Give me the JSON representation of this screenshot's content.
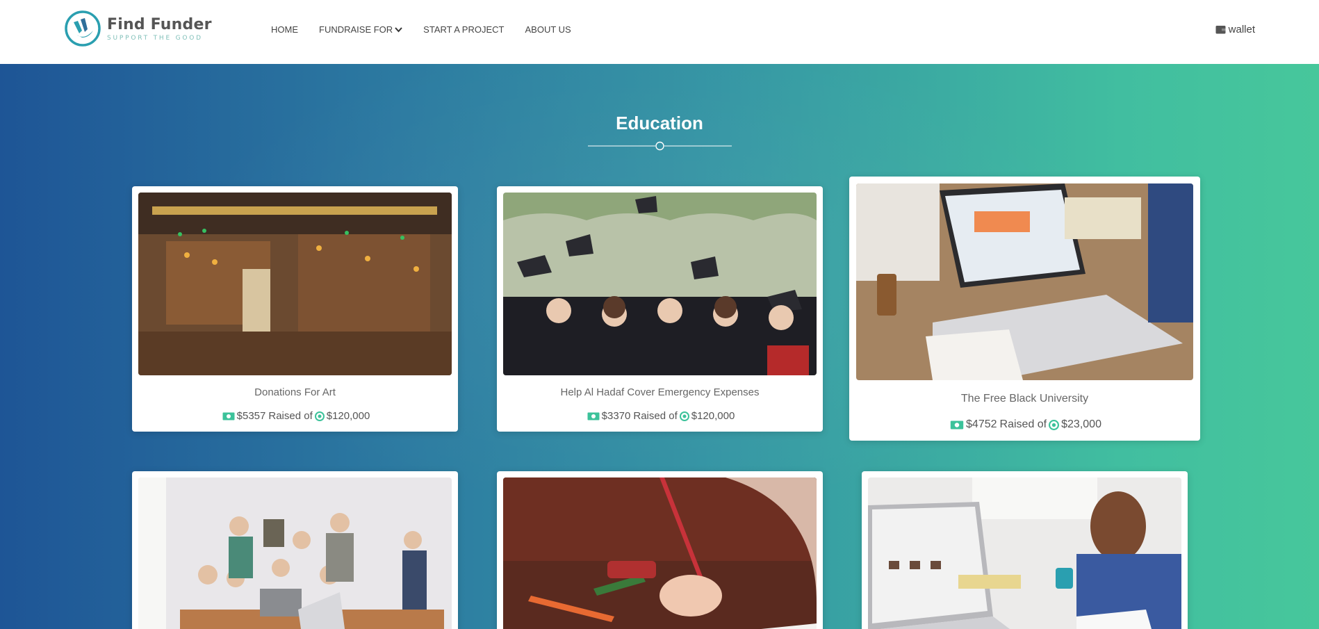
{
  "brand": {
    "name": "Find Funder",
    "tagline": "SUPPORT THE GOOD"
  },
  "nav": {
    "items": [
      {
        "label": "HOME"
      },
      {
        "label": "FUNDRAISE FOR"
      },
      {
        "label": "START A PROJECT"
      },
      {
        "label": "ABOUT US"
      }
    ],
    "wallet_label": "wallet"
  },
  "section": {
    "title": "Education"
  },
  "cards": [
    {
      "title": "Donations For Art",
      "raised": "$5357",
      "raised_of": "Raised of",
      "goal": "$120,000",
      "image": "library-reading-room"
    },
    {
      "title": "Help Al Hadaf Cover Emergency Expenses",
      "raised": "$3370",
      "raised_of": "Raised of",
      "goal": "$120,000",
      "image": "graduation-caps"
    },
    {
      "title": "The Free Black University",
      "raised": "$4752",
      "raised_of": "Raised of",
      "goal": "$23,000",
      "image": "laptop-desk"
    },
    {
      "image": "group-studying"
    },
    {
      "image": "child-drawing"
    },
    {
      "image": "man-writing-laptop"
    }
  ],
  "colors": {
    "accent": "#3cc29a",
    "gradient_start": "#1e5596",
    "gradient_end": "#47c79b",
    "logo": "#2a9fb0"
  },
  "icons": {
    "money": "money-bill-icon",
    "goal": "target-icon",
    "wallet": "wallet-icon",
    "dropdown": "chevron-down-icon"
  }
}
